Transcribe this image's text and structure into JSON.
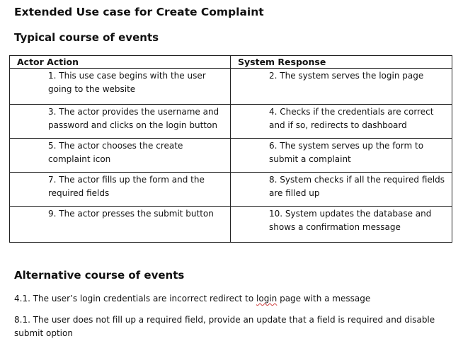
{
  "title": "Extended Use case for Create Complaint",
  "typical": {
    "heading": "Typical course of events",
    "columns": [
      "Actor Action",
      "System Response"
    ],
    "rows": [
      {
        "actor": "1. This use case begins with the user going to the website",
        "system": "2. The system serves the login page"
      },
      {
        "actor": "3. The actor provides the username and password and clicks on the login button",
        "system": "4. Checks if the credentials are correct and if so, redirects to dashboard"
      },
      {
        "actor": "5. The actor chooses the create complaint icon",
        "system": "6. The system serves up the form to submit a complaint"
      },
      {
        "actor": "7. The actor fills up the form and the required fields",
        "system": "8. System checks if all the required fields are filled up"
      },
      {
        "actor": "9. The actor presses the submit button",
        "system": "10. System updates the database and shows a confirmation message"
      }
    ]
  },
  "alternative": {
    "heading": "Alternative course of events",
    "items": [
      {
        "before": "4.1. The user’s login credentials are incorrect redirect to ",
        "flagged": "login",
        "after": " page with a message"
      },
      {
        "text": "8.1. The user does not fill up a required field, provide an update that a field is required and disable submit option"
      }
    ]
  }
}
